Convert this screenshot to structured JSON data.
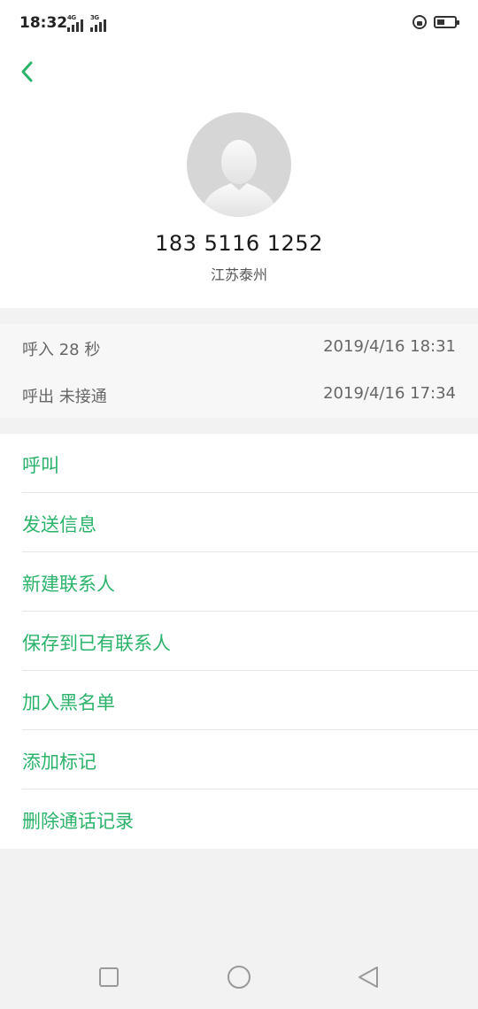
{
  "status_bar": {
    "time": "18:32",
    "signal_1_label": "4G",
    "signal_2_label": "3G",
    "battery_level": 0.45
  },
  "header": {
    "back_icon": "chevron-left-icon",
    "avatar_icon": "default-person-avatar",
    "phone_number": "183 5116 1252",
    "location": "江苏泰州"
  },
  "history": [
    {
      "type": "呼入  28 秒",
      "time": "2019/4/16 18:31"
    },
    {
      "type": "呼出 未接通",
      "time": "2019/4/16 17:34"
    }
  ],
  "actions": [
    {
      "label": "呼叫"
    },
    {
      "label": "发送信息"
    },
    {
      "label": "新建联系人"
    },
    {
      "label": "保存到已有联系人"
    },
    {
      "label": "加入黑名单"
    },
    {
      "label": "添加标记"
    },
    {
      "label": "删除通话记录"
    }
  ],
  "nav": {
    "recents_icon": "square-icon",
    "home_icon": "circle-icon",
    "back_icon": "triangle-back-icon"
  },
  "colors": {
    "accent": "#2bb36b",
    "background": "#f2f2f2"
  }
}
